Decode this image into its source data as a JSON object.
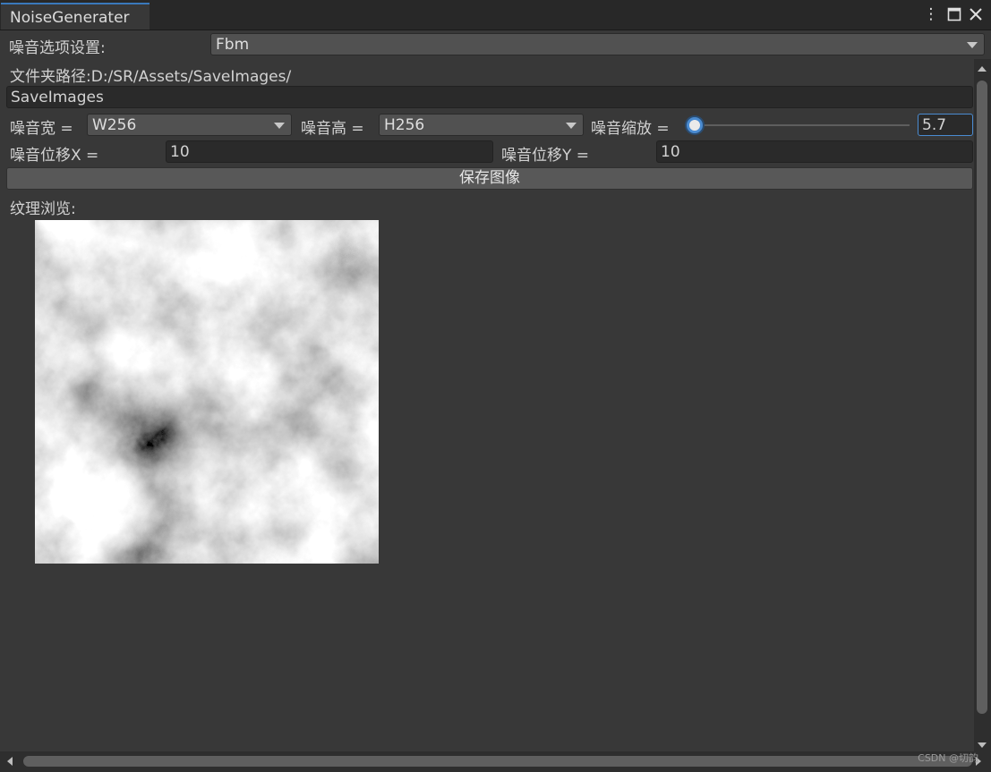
{
  "window": {
    "tab_title": "NoiseGenerater",
    "controls": {
      "menu_icon": "kebab-menu-icon",
      "maximize_icon": "maximize-icon",
      "close_icon": "close-icon"
    }
  },
  "noise_options": {
    "label": "噪音选项设置:",
    "selected": "Fbm"
  },
  "folder_path": {
    "label": "文件夹路径:D:/SR/Assets/SaveImages/",
    "input_value": "SaveImages"
  },
  "size_row": {
    "width_label": "噪音宽 =",
    "width_value": "W256",
    "height_label": "噪音高 =",
    "height_value": "H256",
    "scale_label": "噪音缩放 =",
    "scale_value": "5.7",
    "scale_slider_level": 0.04
  },
  "offset_row": {
    "x_label": "噪音位移X =",
    "x_value": "10",
    "y_label": "噪音位移Y =",
    "y_value": "10"
  },
  "save_button": "保存图像",
  "preview": {
    "label": "纹理浏览:"
  },
  "colors": {
    "background": "#383838",
    "accent": "#3a79bb"
  },
  "watermark": "CSDN @切韵"
}
